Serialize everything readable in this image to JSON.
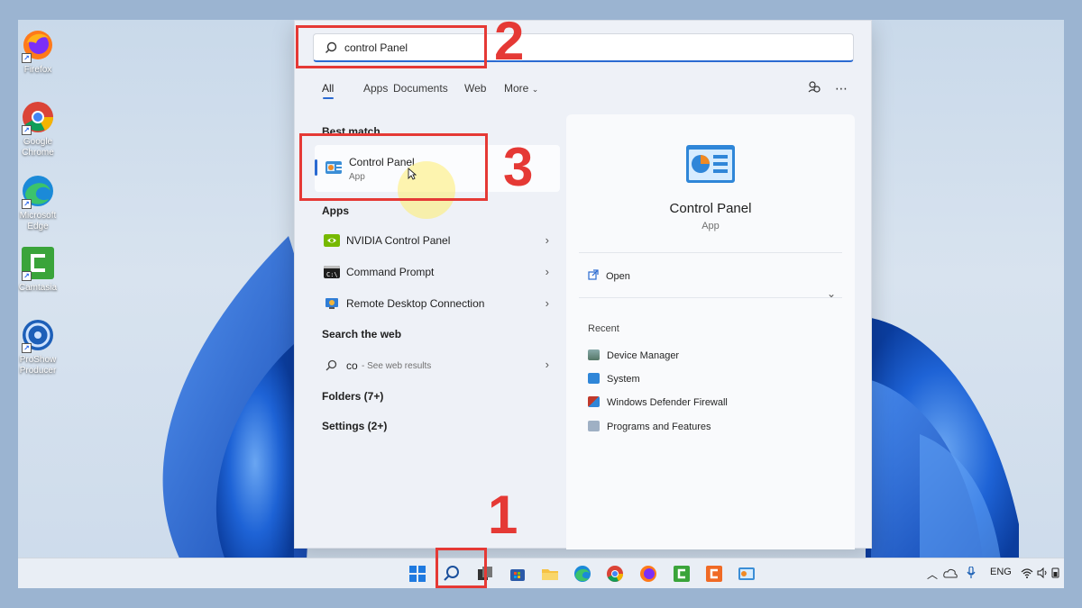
{
  "desktop": {
    "icons": [
      {
        "label": "Firefox",
        "icon": "firefox-icon"
      },
      {
        "label": "Google Chrome",
        "icon": "chrome-icon"
      },
      {
        "label": "Microsoft Edge",
        "icon": "edge-icon"
      },
      {
        "label": "Camtasia",
        "icon": "camtasia-icon"
      },
      {
        "label": "ProShow Producer",
        "icon": "proshow-icon"
      }
    ]
  },
  "search": {
    "query": "control Panel",
    "tabs": [
      "All",
      "Apps",
      "Documents",
      "Web",
      "More"
    ],
    "active_tab": "All"
  },
  "results": {
    "best_match_title": "Best match",
    "best_match": {
      "name": "Control Panel",
      "type": "App"
    },
    "apps_title": "Apps",
    "apps": [
      {
        "name": "NVIDIA Control Panel"
      },
      {
        "name": "Command Prompt"
      },
      {
        "name": "Remote Desktop Connection"
      }
    ],
    "web_title": "Search the web",
    "web": {
      "query": "co",
      "hint": "- See web results"
    },
    "folders": "Folders (7+)",
    "settings": "Settings (2+)"
  },
  "preview": {
    "name": "Control Panel",
    "type": "App",
    "open_label": "Open",
    "recent_title": "Recent",
    "recent": [
      {
        "name": "Device Manager"
      },
      {
        "name": "System"
      },
      {
        "name": "Windows Defender Firewall"
      },
      {
        "name": "Programs and Features"
      }
    ]
  },
  "annotations": {
    "step1": "1",
    "step2": "2",
    "step3": "3"
  },
  "taskbar": {
    "language": "ENG"
  },
  "colors": {
    "accent": "#2a6ad1",
    "annotation": "#e53935",
    "wallpaper_bloom": "#1e63d6"
  }
}
